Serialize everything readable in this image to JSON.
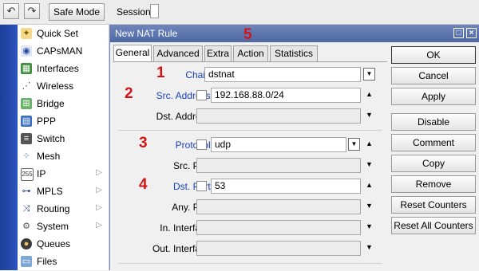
{
  "toolbar": {
    "undo_icon": "undo-icon",
    "redo_icon": "redo-icon",
    "safe_mode_label": "Safe Mode",
    "session_label": "Session:"
  },
  "sidebar": {
    "items": [
      {
        "label": "Quick Set",
        "icon": "quick-set-icon",
        "submenu": false
      },
      {
        "label": "CAPsMAN",
        "icon": "capsman-icon",
        "submenu": false
      },
      {
        "label": "Interfaces",
        "icon": "interfaces-icon",
        "submenu": false
      },
      {
        "label": "Wireless",
        "icon": "wireless-icon",
        "submenu": false
      },
      {
        "label": "Bridge",
        "icon": "bridge-icon",
        "submenu": false
      },
      {
        "label": "PPP",
        "icon": "ppp-icon",
        "submenu": false
      },
      {
        "label": "Switch",
        "icon": "switch-icon",
        "submenu": false
      },
      {
        "label": "Mesh",
        "icon": "mesh-icon",
        "submenu": false
      },
      {
        "label": "IP",
        "icon": "ip-icon",
        "submenu": true
      },
      {
        "label": "MPLS",
        "icon": "mpls-icon",
        "submenu": true
      },
      {
        "label": "Routing",
        "icon": "routing-icon",
        "submenu": true
      },
      {
        "label": "System",
        "icon": "system-icon",
        "submenu": true
      },
      {
        "label": "Queues",
        "icon": "queues-icon",
        "submenu": false
      },
      {
        "label": "Files",
        "icon": "files-icon",
        "submenu": false
      }
    ]
  },
  "dialog": {
    "title": "New NAT Rule",
    "tabs": [
      "General",
      "Advanced",
      "Extra",
      "Action",
      "Statistics"
    ],
    "active_tab": "General",
    "annotation_tab_number": "5",
    "fields": {
      "chain": {
        "label": "Chain:",
        "value": "dstnat",
        "annotation": "1"
      },
      "src_address": {
        "label": "Src. Address:",
        "value": "192.168.88.0/24",
        "annotation": "2"
      },
      "dst_address": {
        "label": "Dst. Address:",
        "value": ""
      },
      "protocol": {
        "label": "Protocol:",
        "value": "udp",
        "annotation": "3"
      },
      "src_port": {
        "label": "Src. Port:",
        "value": ""
      },
      "dst_port": {
        "label": "Dst. Port:",
        "value": "53",
        "annotation": "4"
      },
      "any_port": {
        "label": "Any. Port:",
        "value": ""
      },
      "in_interface": {
        "label": "In. Interface:",
        "value": ""
      },
      "out_interface": {
        "label": "Out. Interface:",
        "value": ""
      }
    },
    "buttons": [
      "OK",
      "Cancel",
      "Apply",
      "Disable",
      "Comment",
      "Copy",
      "Remove",
      "Reset Counters",
      "Reset All Counters"
    ]
  },
  "colors": {
    "annotation": "#d21414",
    "title_bar": "#5a72ad",
    "blue_label": "#1a3fb5",
    "left_strip": "#2447a8"
  }
}
